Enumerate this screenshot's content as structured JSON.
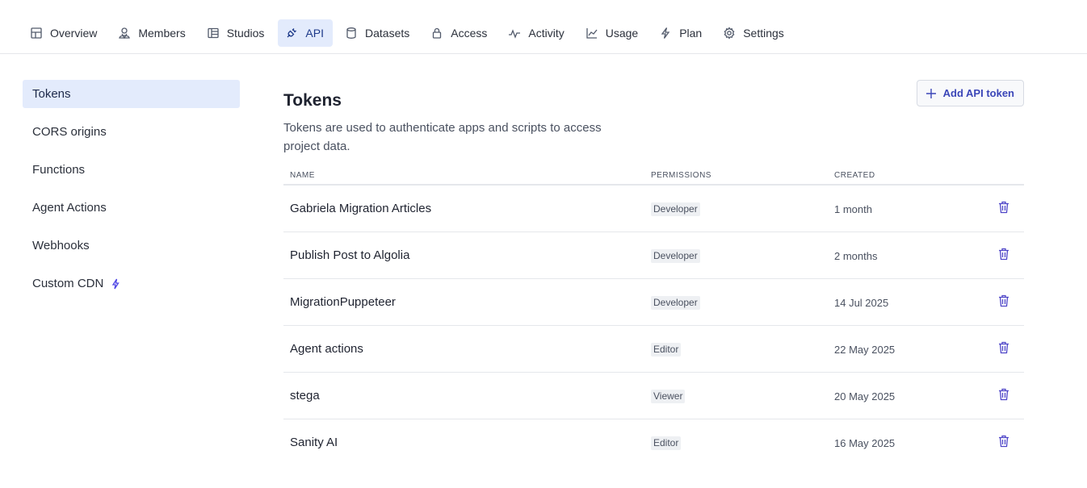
{
  "nav": {
    "tabs": [
      {
        "label": "Overview",
        "icon": "table-icon"
      },
      {
        "label": "Members",
        "icon": "members-icon"
      },
      {
        "label": "Studios",
        "icon": "studio-icon"
      },
      {
        "label": "API",
        "icon": "plug-icon",
        "active": true
      },
      {
        "label": "Datasets",
        "icon": "database-icon"
      },
      {
        "label": "Access",
        "icon": "lock-icon"
      },
      {
        "label": "Activity",
        "icon": "activity-icon"
      },
      {
        "label": "Usage",
        "icon": "chart-icon"
      },
      {
        "label": "Plan",
        "icon": "bolt-icon"
      },
      {
        "label": "Settings",
        "icon": "gear-icon"
      }
    ]
  },
  "sidebar": {
    "items": [
      {
        "label": "Tokens",
        "active": true
      },
      {
        "label": "CORS origins"
      },
      {
        "label": "Functions"
      },
      {
        "label": "Agent Actions"
      },
      {
        "label": "Webhooks"
      },
      {
        "label": "Custom CDN",
        "badge_icon": "bolt-icon"
      }
    ]
  },
  "main": {
    "title": "Tokens",
    "description": "Tokens are used to authenticate apps and scripts to access project data.",
    "add_button": "Add API token",
    "table": {
      "headers": {
        "name": "NAME",
        "permissions": "PERMISSIONS",
        "created": "CREATED"
      },
      "rows": [
        {
          "name": "Gabriela Migration Articles",
          "permission": "Developer",
          "created": "1 month"
        },
        {
          "name": "Publish Post to Algolia",
          "permission": "Developer",
          "created": "2 months"
        },
        {
          "name": "MigrationPuppeteer",
          "permission": "Developer",
          "created": "14 Jul 2025"
        },
        {
          "name": "Agent actions",
          "permission": "Editor",
          "created": "22 May 2025"
        },
        {
          "name": "stega",
          "permission": "Viewer",
          "created": "20 May 2025"
        },
        {
          "name": "Sanity AI",
          "permission": "Editor",
          "created": "16 May 2025"
        }
      ]
    }
  },
  "colors": {
    "accent": "#3b46b8",
    "active_bg": "#e3ebfc",
    "border": "#e5e7eb"
  }
}
